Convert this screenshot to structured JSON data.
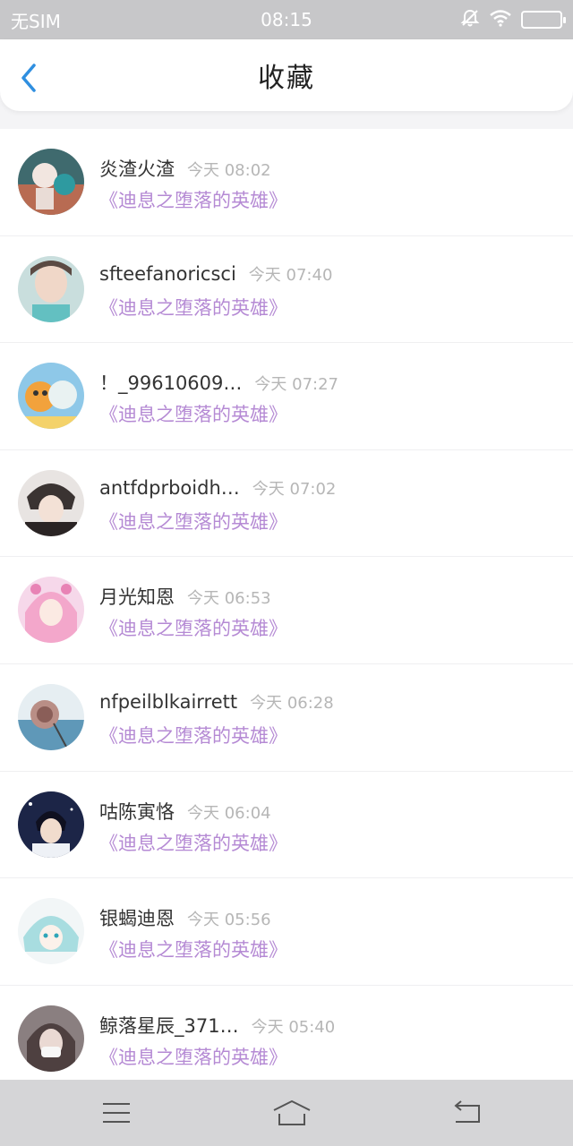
{
  "status_bar": {
    "carrier": "无SIM",
    "time": "08:15",
    "icons": [
      "bell-off-icon",
      "wifi-icon",
      "battery-icon"
    ]
  },
  "header": {
    "title": "收藏",
    "back_icon": "chevron-left-icon"
  },
  "colors": {
    "accent": "#2f8fe0",
    "book_title": "#b58ad4",
    "timestamp": "#b6b6b6"
  },
  "items": [
    {
      "name": "炎渣火渣",
      "time": "今天 08:02",
      "book": "《迪息之堕落的英雄》"
    },
    {
      "name": "sfteefanoricsci",
      "time": "今天 07:40",
      "book": "《迪息之堕落的英雄》"
    },
    {
      "name": "！_99610609…",
      "time": "今天 07:27",
      "book": "《迪息之堕落的英雄》"
    },
    {
      "name": "antfdprboidh…",
      "time": "今天 07:02",
      "book": "《迪息之堕落的英雄》"
    },
    {
      "name": "月光知恩",
      "time": "今天 06:53",
      "book": "《迪息之堕落的英雄》"
    },
    {
      "name": "nfpeilblkairrett",
      "time": "今天 06:28",
      "book": "《迪息之堕落的英雄》"
    },
    {
      "name": "咕陈寅恪",
      "time": "今天 06:04",
      "book": "《迪息之堕落的英雄》"
    },
    {
      "name": "银蝎迪恩",
      "time": "今天 05:56",
      "book": "《迪息之堕落的英雄》"
    },
    {
      "name": "鲸落星辰_371…",
      "time": "今天 05:40",
      "book": "《迪息之堕落的英雄》"
    }
  ],
  "nav": {
    "icons": [
      "menu-icon",
      "home-icon",
      "back-icon"
    ]
  }
}
